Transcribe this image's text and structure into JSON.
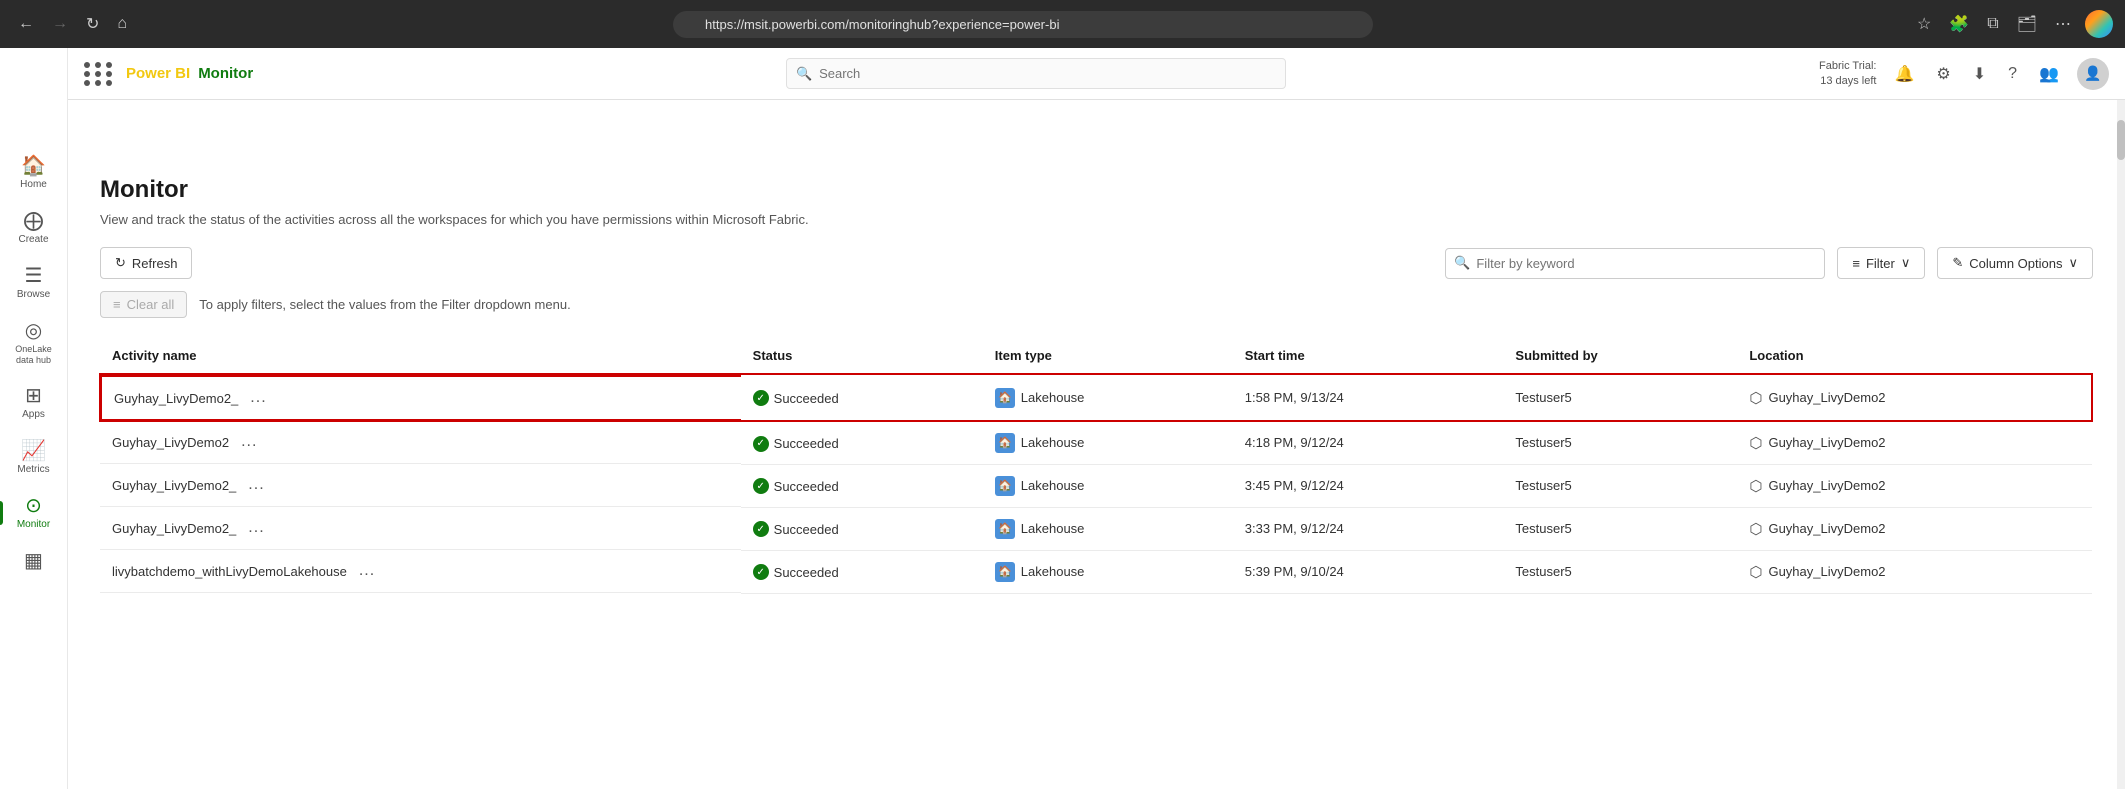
{
  "browser": {
    "url": "https://msit.powerbi.com/monitoringhub?experience=power-bi",
    "back_disabled": false,
    "forward_disabled": true
  },
  "topbar": {
    "app_name": "Power BI",
    "section_name": "Monitor",
    "search_placeholder": "Search",
    "fabric_trial_line1": "Fabric Trial:",
    "fabric_trial_line2": "13 days left",
    "dots_icon": "⋯",
    "bell_icon": "🔔",
    "settings_icon": "⚙",
    "download_icon": "⬇",
    "help_icon": "?",
    "profile_icon": "👤"
  },
  "sidebar": {
    "items": [
      {
        "id": "home",
        "icon": "🏠",
        "label": "Home"
      },
      {
        "id": "create",
        "icon": "⊕",
        "label": "Create"
      },
      {
        "id": "browse",
        "icon": "☰",
        "label": "Browse"
      },
      {
        "id": "onelake",
        "icon": "◎",
        "label": "OneLake\ndata hub"
      },
      {
        "id": "apps",
        "icon": "⊞",
        "label": "Apps"
      },
      {
        "id": "metrics",
        "icon": "📊",
        "label": "Metrics"
      },
      {
        "id": "monitor",
        "icon": "⊙",
        "label": "Monitor",
        "active": true
      },
      {
        "id": "workspaces",
        "icon": "▦",
        "label": ""
      }
    ]
  },
  "page": {
    "title": "Monitor",
    "description": "View and track the status of the activities across all the workspaces for which you have permissions within Microsoft Fabric."
  },
  "toolbar": {
    "refresh_label": "Refresh",
    "filter_keyword_placeholder": "Filter by keyword",
    "filter_label": "Filter",
    "column_options_label": "Column Options",
    "clear_all_label": "Clear all",
    "filter_hint": "To apply filters, select the values from the Filter dropdown menu."
  },
  "table": {
    "columns": [
      {
        "id": "activity_name",
        "label": "Activity name"
      },
      {
        "id": "status",
        "label": "Status"
      },
      {
        "id": "item_type",
        "label": "Item type"
      },
      {
        "id": "start_time",
        "label": "Start time"
      },
      {
        "id": "submitted_by",
        "label": "Submitted by"
      },
      {
        "id": "location",
        "label": "Location"
      }
    ],
    "rows": [
      {
        "activity_name": "Guyhay_LivyDemo2_",
        "status": "Succeeded",
        "item_type": "Lakehouse",
        "start_time": "1:58 PM, 9/13/24",
        "submitted_by": "Testuser5",
        "location": "Guyhay_LivyDemo2",
        "highlighted": true
      },
      {
        "activity_name": "Guyhay_LivyDemo2",
        "status": "Succeeded",
        "item_type": "Lakehouse",
        "start_time": "4:18 PM, 9/12/24",
        "submitted_by": "Testuser5",
        "location": "Guyhay_LivyDemo2",
        "highlighted": false
      },
      {
        "activity_name": "Guyhay_LivyDemo2_",
        "status": "Succeeded",
        "item_type": "Lakehouse",
        "start_time": "3:45 PM, 9/12/24",
        "submitted_by": "Testuser5",
        "location": "Guyhay_LivyDemo2",
        "highlighted": false
      },
      {
        "activity_name": "Guyhay_LivyDemo2_",
        "status": "Succeeded",
        "item_type": "Lakehouse",
        "start_time": "3:33 PM, 9/12/24",
        "submitted_by": "Testuser5",
        "location": "Guyhay_LivyDemo2",
        "highlighted": false
      },
      {
        "activity_name": "livybatchdemo_withLivyDemoLakehouse",
        "status": "Succeeded",
        "item_type": "Lakehouse",
        "start_time": "5:39 PM, 9/10/24",
        "submitted_by": "Testuser5",
        "location": "Guyhay_LivyDemo2",
        "highlighted": false
      }
    ]
  }
}
